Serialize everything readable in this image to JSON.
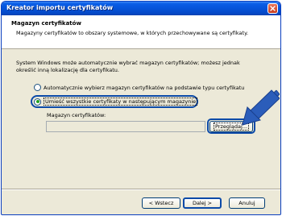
{
  "window": {
    "title": "Kreator importu certyfikatów"
  },
  "header": {
    "title": "Magazyn certyfikatów",
    "description": "Magazyny certyfikatów to obszary systemowe, w których przechowywane są certyfikaty."
  },
  "main": {
    "intro_line1": "System Windows może automatycznie wybrać magazyn certyfikatów; możesz jednak",
    "intro_line2": "określić inną lokalizację dla certyfikatu.",
    "option_auto": "Automatycznie wybierz magazyn certyfikatów na podstawie typu certyfikatu",
    "option_manual": "Umieść wszystkie certyfikaty w następującym magazynie",
    "selected_option": "option_manual",
    "store_label": "Magazyn certyfikatów:",
    "store_value": "",
    "browse_label": "Przeglądaj..."
  },
  "footer": {
    "back_label": "< Wstecz",
    "next_label": "Dalej >",
    "cancel_label": "Anuluj"
  },
  "colors": {
    "accent": "#0b4aa8",
    "title_bar": "#0553d9",
    "face": "#ece9d8"
  },
  "icons": {
    "close": "close-icon",
    "arrow": "pointer-arrow-icon"
  }
}
